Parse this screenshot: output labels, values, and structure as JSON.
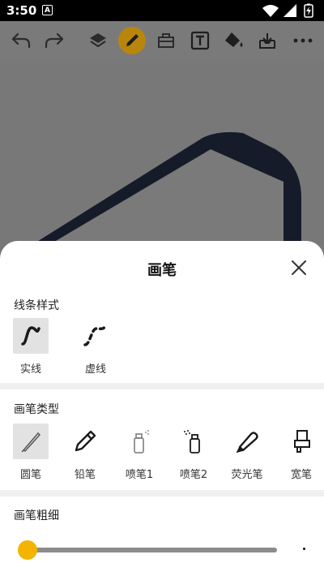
{
  "status_bar": {
    "time": "3:50",
    "notification_badge": "A"
  },
  "toolbar": {
    "icons": [
      "undo-icon",
      "redo-icon",
      "layers-icon",
      "brush-icon",
      "toolbox-icon",
      "text-tool-icon",
      "fill-bucket-icon",
      "save-download-icon",
      "more-icon"
    ],
    "active": "brush-icon",
    "active_color": "#b8860b"
  },
  "sheet": {
    "title": "画笔",
    "line_style": {
      "label": "线条样式",
      "options": [
        {
          "label": "实线",
          "selected": true
        },
        {
          "label": "虚线",
          "selected": false
        }
      ]
    },
    "brush_type": {
      "label": "画笔类型",
      "options": [
        {
          "label": "圆笔",
          "selected": true
        },
        {
          "label": "铅笔",
          "selected": false
        },
        {
          "label": "喷笔1",
          "selected": false
        },
        {
          "label": "喷笔2",
          "selected": false
        },
        {
          "label": "荧光笔",
          "selected": false
        },
        {
          "label": "宽笔",
          "selected": false
        }
      ]
    },
    "brush_size": {
      "label": "画笔粗细",
      "value_fraction": 0.0,
      "thumb_color": "#f4b400"
    }
  }
}
